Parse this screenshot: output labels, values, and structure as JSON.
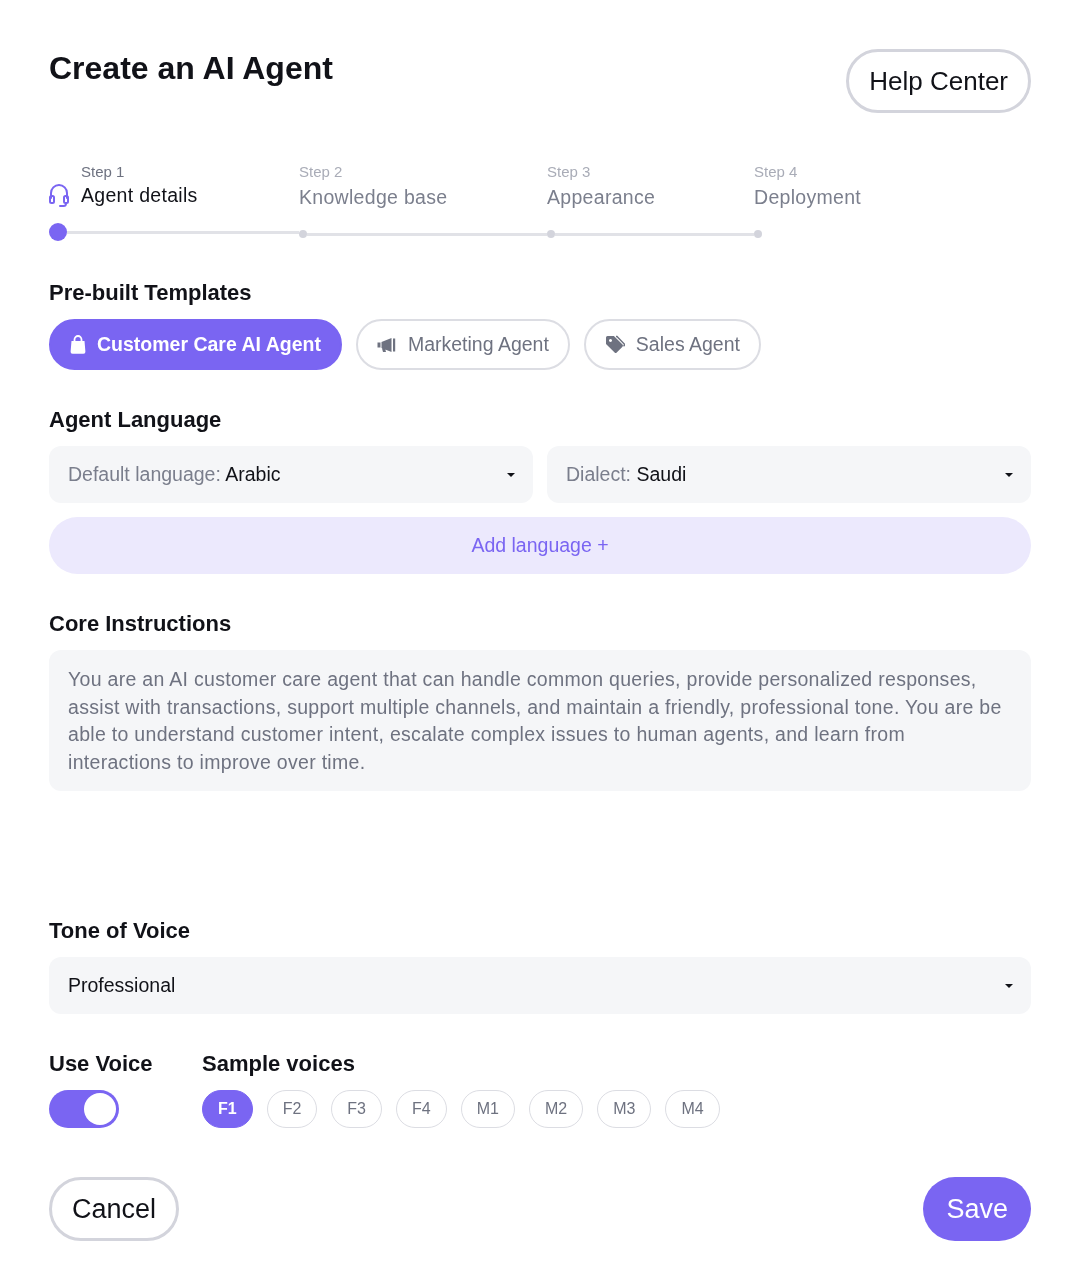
{
  "header": {
    "title": "Create an AI Agent",
    "help_button": "Help Center"
  },
  "stepper": {
    "steps": [
      {
        "step": "Step 1",
        "label": "Agent details",
        "selected": true
      },
      {
        "step": "Step 2",
        "label": "Knowledge base",
        "selected": false
      },
      {
        "step": "Step 3",
        "label": "Appearance",
        "selected": false
      },
      {
        "step": "Step 4",
        "label": "Deployment",
        "selected": false
      }
    ]
  },
  "templates": {
    "heading": "Pre-built Templates",
    "items": [
      {
        "label": "Customer Care AI Agent",
        "selected": true
      },
      {
        "label": "Marketing Agent",
        "selected": false
      },
      {
        "label": "Sales Agent",
        "selected": false
      }
    ]
  },
  "language": {
    "heading": "Agent Language",
    "fields": [
      {
        "label": "Default language:",
        "value": "Arabic"
      },
      {
        "label": "Dialect:",
        "value": "Saudi"
      }
    ],
    "add_button": "Add language +"
  },
  "instructions": {
    "heading": "Core Instructions",
    "value": "You are an AI customer care agent that can handle common queries, provide personalized responses, assist with transactions, support multiple channels, and maintain a friendly, professional tone. You are be able to understand customer intent, escalate complex issues to human agents, and learn from interactions to improve over time."
  },
  "tone": {
    "heading": "Tone of Voice",
    "value": "Professional"
  },
  "voice": {
    "heading": "Use Voice",
    "on": true
  },
  "samples": {
    "heading": "Sample voices",
    "items": [
      {
        "label": "F1",
        "selected": true
      },
      {
        "label": "F2",
        "selected": false
      },
      {
        "label": "F3",
        "selected": false
      },
      {
        "label": "F4",
        "selected": false
      },
      {
        "label": "M1",
        "selected": false
      },
      {
        "label": "M2",
        "selected": false
      },
      {
        "label": "M3",
        "selected": false
      },
      {
        "label": "M4",
        "selected": false
      }
    ]
  },
  "actions": {
    "cancel": "Cancel",
    "save": "Save"
  }
}
